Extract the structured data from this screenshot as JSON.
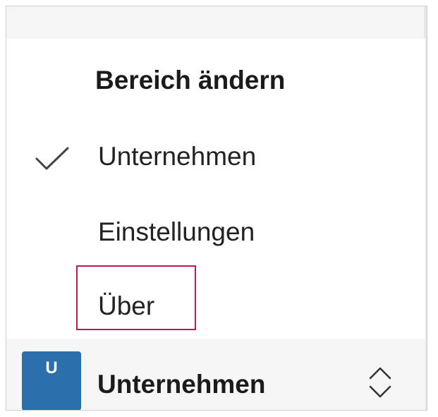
{
  "menu": {
    "heading": "Bereich ändern",
    "items": [
      {
        "label": "Unternehmen",
        "checked": true,
        "icon": "checkmark-icon"
      },
      {
        "label": "Einstellungen",
        "checked": false
      },
      {
        "label": "Über",
        "checked": false,
        "highlighted": true
      }
    ]
  },
  "footer": {
    "avatar_initial": "U",
    "avatar_color": "#2c6fad",
    "label": "Unternehmen",
    "icon": "chevron-up-down-icon"
  },
  "colors": {
    "highlight": "#c2185b",
    "panel_background": "#ffffff",
    "footer_background": "#f6f6f6"
  }
}
